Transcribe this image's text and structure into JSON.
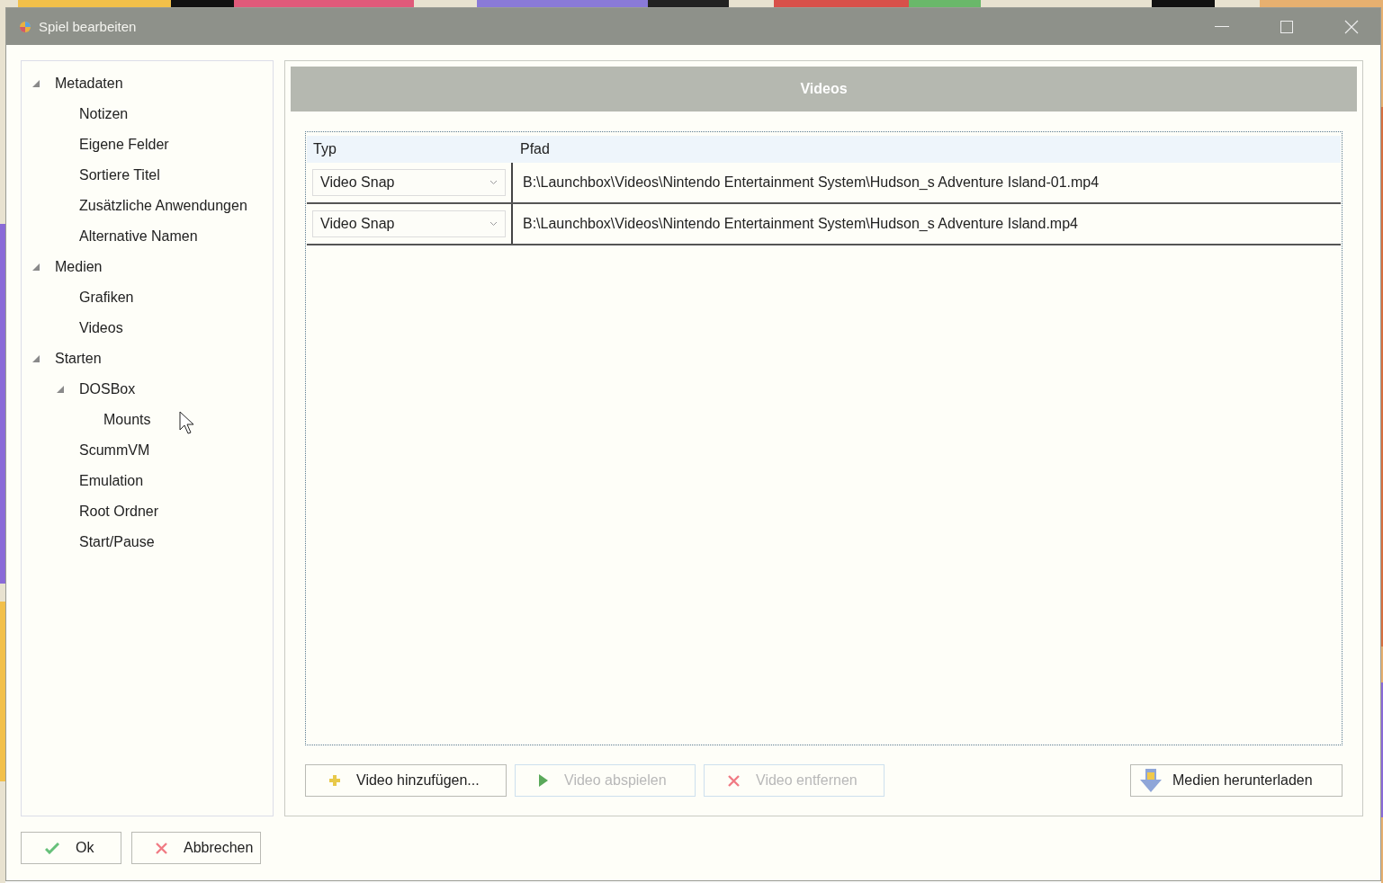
{
  "window": {
    "title": "Spiel bearbeiten"
  },
  "tree": [
    {
      "label": "Metadaten",
      "expanded": true,
      "children": [
        {
          "label": "Notizen"
        },
        {
          "label": "Eigene Felder"
        },
        {
          "label": "Sortiere Titel"
        },
        {
          "label": "Zusätzliche Anwendungen"
        },
        {
          "label": "Alternative Namen"
        }
      ]
    },
    {
      "label": "Medien",
      "expanded": true,
      "children": [
        {
          "label": "Grafiken"
        },
        {
          "label": "Videos"
        }
      ]
    },
    {
      "label": "Starten",
      "expanded": true,
      "children": [
        {
          "label": "DOSBox",
          "expanded": true,
          "children": [
            {
              "label": "Mounts"
            }
          ]
        },
        {
          "label": "ScummVM"
        },
        {
          "label": "Emulation"
        },
        {
          "label": "Root Ordner"
        },
        {
          "label": "Start/Pause"
        }
      ]
    }
  ],
  "panel": {
    "title": "Videos"
  },
  "table": {
    "columns": [
      "Typ",
      "Pfad"
    ],
    "rows": [
      {
        "type": "Video Snap",
        "path": "B:\\Launchbox\\Videos\\Nintendo Entertainment System\\Hudson_s Adventure Island-01.mp4"
      },
      {
        "type": "Video Snap",
        "path": "B:\\Launchbox\\Videos\\Nintendo Entertainment System\\Hudson_s Adventure Island.mp4"
      }
    ]
  },
  "actions": [
    {
      "label": "Video hinzufügen...",
      "kind": "add",
      "disabled": false
    },
    {
      "label": "Video abspielen",
      "kind": "play",
      "disabled": true
    },
    {
      "label": "Video entfernen",
      "kind": "remove",
      "disabled": true
    }
  ],
  "download": {
    "label": "Medien herunterladen",
    "kind": "download",
    "disabled": false
  },
  "footer": [
    {
      "label": "Ok",
      "kind": "confirm",
      "disabled": false
    },
    {
      "label": "Abbrechen",
      "kind": "cancel",
      "disabled": false
    }
  ]
}
